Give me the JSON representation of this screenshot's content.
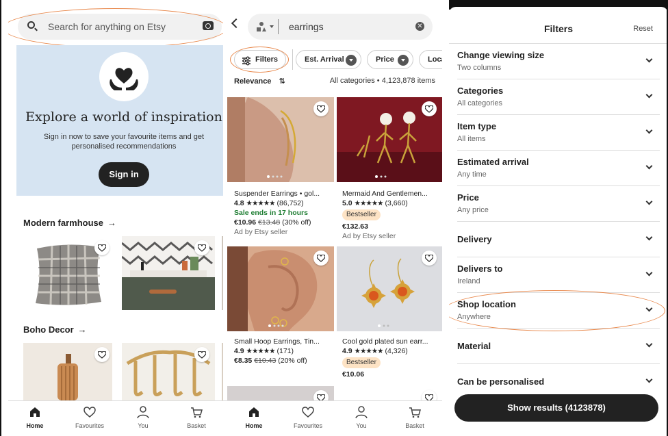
{
  "home": {
    "search_placeholder": "Search for anything on Etsy",
    "hero": {
      "title": "Explore a world of inspiration",
      "subtitle": "Sign in now to save your favourite items and get personalised recommendations",
      "button": "Sign in",
      "background": "#d6e4f2"
    },
    "sections": [
      {
        "title": "Modern farmhouse",
        "arrow": "→"
      },
      {
        "title": "Boho Decor",
        "arrow": "→"
      }
    ]
  },
  "results": {
    "query": "earrings",
    "chips": {
      "filters": "Filters",
      "arrival": "Est. Arrival",
      "price": "Price",
      "location": "Locat"
    },
    "sort_label": "Relevance",
    "sort_icon": "⇅",
    "category_summary": "All categories • 4,123,878 items",
    "products": [
      {
        "title": "Suspender Earrings • gol...",
        "rating": "4.8",
        "stars": "★★★★★",
        "reviews": "(86,752)",
        "sale": "Sale ends in 17 hours",
        "price": "€10.96",
        "old_price": "€13.48",
        "discount": "(30% off)",
        "ad": "Ad by Etsy seller"
      },
      {
        "title": "Mermaid And Gentlemen...",
        "rating": "5.0",
        "stars": "★★★★★",
        "reviews": "(3,660)",
        "badge": "Bestseller",
        "price": "€132.63",
        "ad": "Ad by Etsy seller"
      },
      {
        "title": "Small Hoop Earrings, Tin...",
        "rating": "4.9",
        "stars": "★★★★★",
        "reviews": "(171)",
        "price": "€8.35",
        "old_price": "€10.43",
        "discount": "(20% off)"
      },
      {
        "title": "Cool gold plated sun earr...",
        "rating": "4.9",
        "stars": "★★★★★",
        "reviews": "(4,326)",
        "badge": "Bestseller",
        "price": "€10.06"
      }
    ]
  },
  "filters": {
    "title": "Filters",
    "reset": "Reset",
    "rows": [
      {
        "label": "Change viewing size",
        "value": "Two columns"
      },
      {
        "label": "Categories",
        "value": "All categories"
      },
      {
        "label": "Item type",
        "value": "All items"
      },
      {
        "label": "Estimated arrival",
        "value": "Any time"
      },
      {
        "label": "Price",
        "value": "Any price"
      },
      {
        "label": "Delivery",
        "value": ""
      },
      {
        "label": "Delivers to",
        "value": "Ireland"
      },
      {
        "label": "Shop location",
        "value": "Anywhere"
      },
      {
        "label": "Material",
        "value": ""
      },
      {
        "label": "Can be personalised",
        "value": ""
      }
    ],
    "show_results": "Show results (4123878)"
  },
  "nav": [
    "Home",
    "Favourites",
    "You",
    "Basket"
  ],
  "colors": {
    "accent_oval": "#e8874a",
    "dark_button": "#222222",
    "sale_green": "#1e7d32",
    "bestseller_bg": "#fde3c5"
  }
}
